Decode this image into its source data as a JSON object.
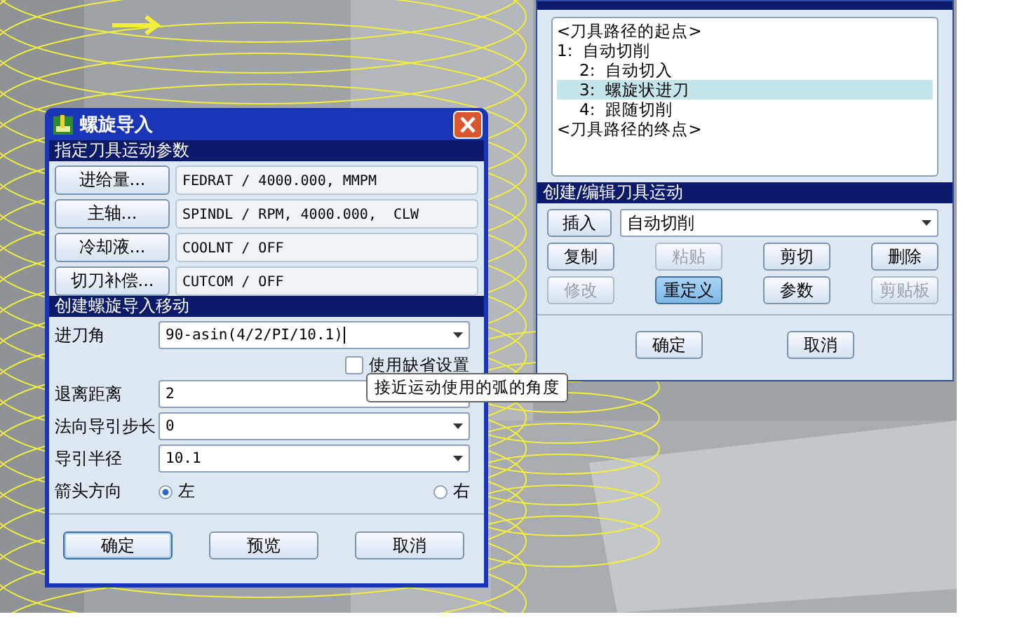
{
  "dialog": {
    "title": "螺旋导入",
    "params_section": "指定刀具运动参数",
    "params": [
      {
        "button": "进给量...",
        "value": "FEDRAT / 4000.000, MMPM"
      },
      {
        "button": "主轴...",
        "value": "SPINDL / RPM, 4000.000,  CLW"
      },
      {
        "button": "冷却液...",
        "value": "COOLNT / OFF"
      },
      {
        "button": "切刀补偿...",
        "value": "CUTCOM / OFF"
      }
    ],
    "move_section": "创建螺旋导入移动",
    "angle": {
      "label": "进刀角",
      "value": "90-asin(4/2/PI/10.1)"
    },
    "default_checkbox": {
      "label": "使用缺省设置",
      "checked": false
    },
    "tooltip": "接近运动使用的弧的角度",
    "fields": [
      {
        "label": "退离距离",
        "value": "2"
      },
      {
        "label": "法向导引步长",
        "value": "0"
      },
      {
        "label": "导引半径",
        "value": "10.1"
      }
    ],
    "direction": {
      "label": "箭头方向",
      "options": [
        {
          "label": "左",
          "selected": true
        },
        {
          "label": "右",
          "selected": false
        }
      ]
    },
    "buttons": [
      {
        "label": "确定",
        "default": true
      },
      {
        "label": "预览",
        "default": false
      },
      {
        "label": "取消",
        "default": false
      }
    ]
  },
  "panel": {
    "list": [
      {
        "text": "<刀具路径的起点>",
        "selected": false
      },
      {
        "text": "1:  自动切削",
        "selected": false,
        "children": [
          {
            "text": "2:  自动切入",
            "selected": false
          },
          {
            "text": "3:  螺旋状进刀",
            "selected": true
          },
          {
            "text": "4:  跟随切削",
            "selected": false
          }
        ]
      },
      {
        "text": "<刀具路径的终点>",
        "selected": false
      }
    ],
    "edit_section": "创建/编辑刀具运动",
    "insert": {
      "button": "插入",
      "value": "自动切削"
    },
    "tools": [
      {
        "label": "复制",
        "disabled": false,
        "pressed": false
      },
      {
        "label": "粘贴",
        "disabled": true,
        "pressed": false
      },
      {
        "label": "剪切",
        "disabled": false,
        "pressed": false
      },
      {
        "label": "删除",
        "disabled": false,
        "pressed": false
      },
      {
        "label": "修改",
        "disabled": true,
        "pressed": false
      },
      {
        "label": "重定义",
        "disabled": false,
        "pressed": true
      },
      {
        "label": "参数",
        "disabled": false,
        "pressed": false
      },
      {
        "label": "剪贴板",
        "disabled": true,
        "pressed": false
      }
    ],
    "buttons": [
      "确定",
      "取消"
    ]
  }
}
